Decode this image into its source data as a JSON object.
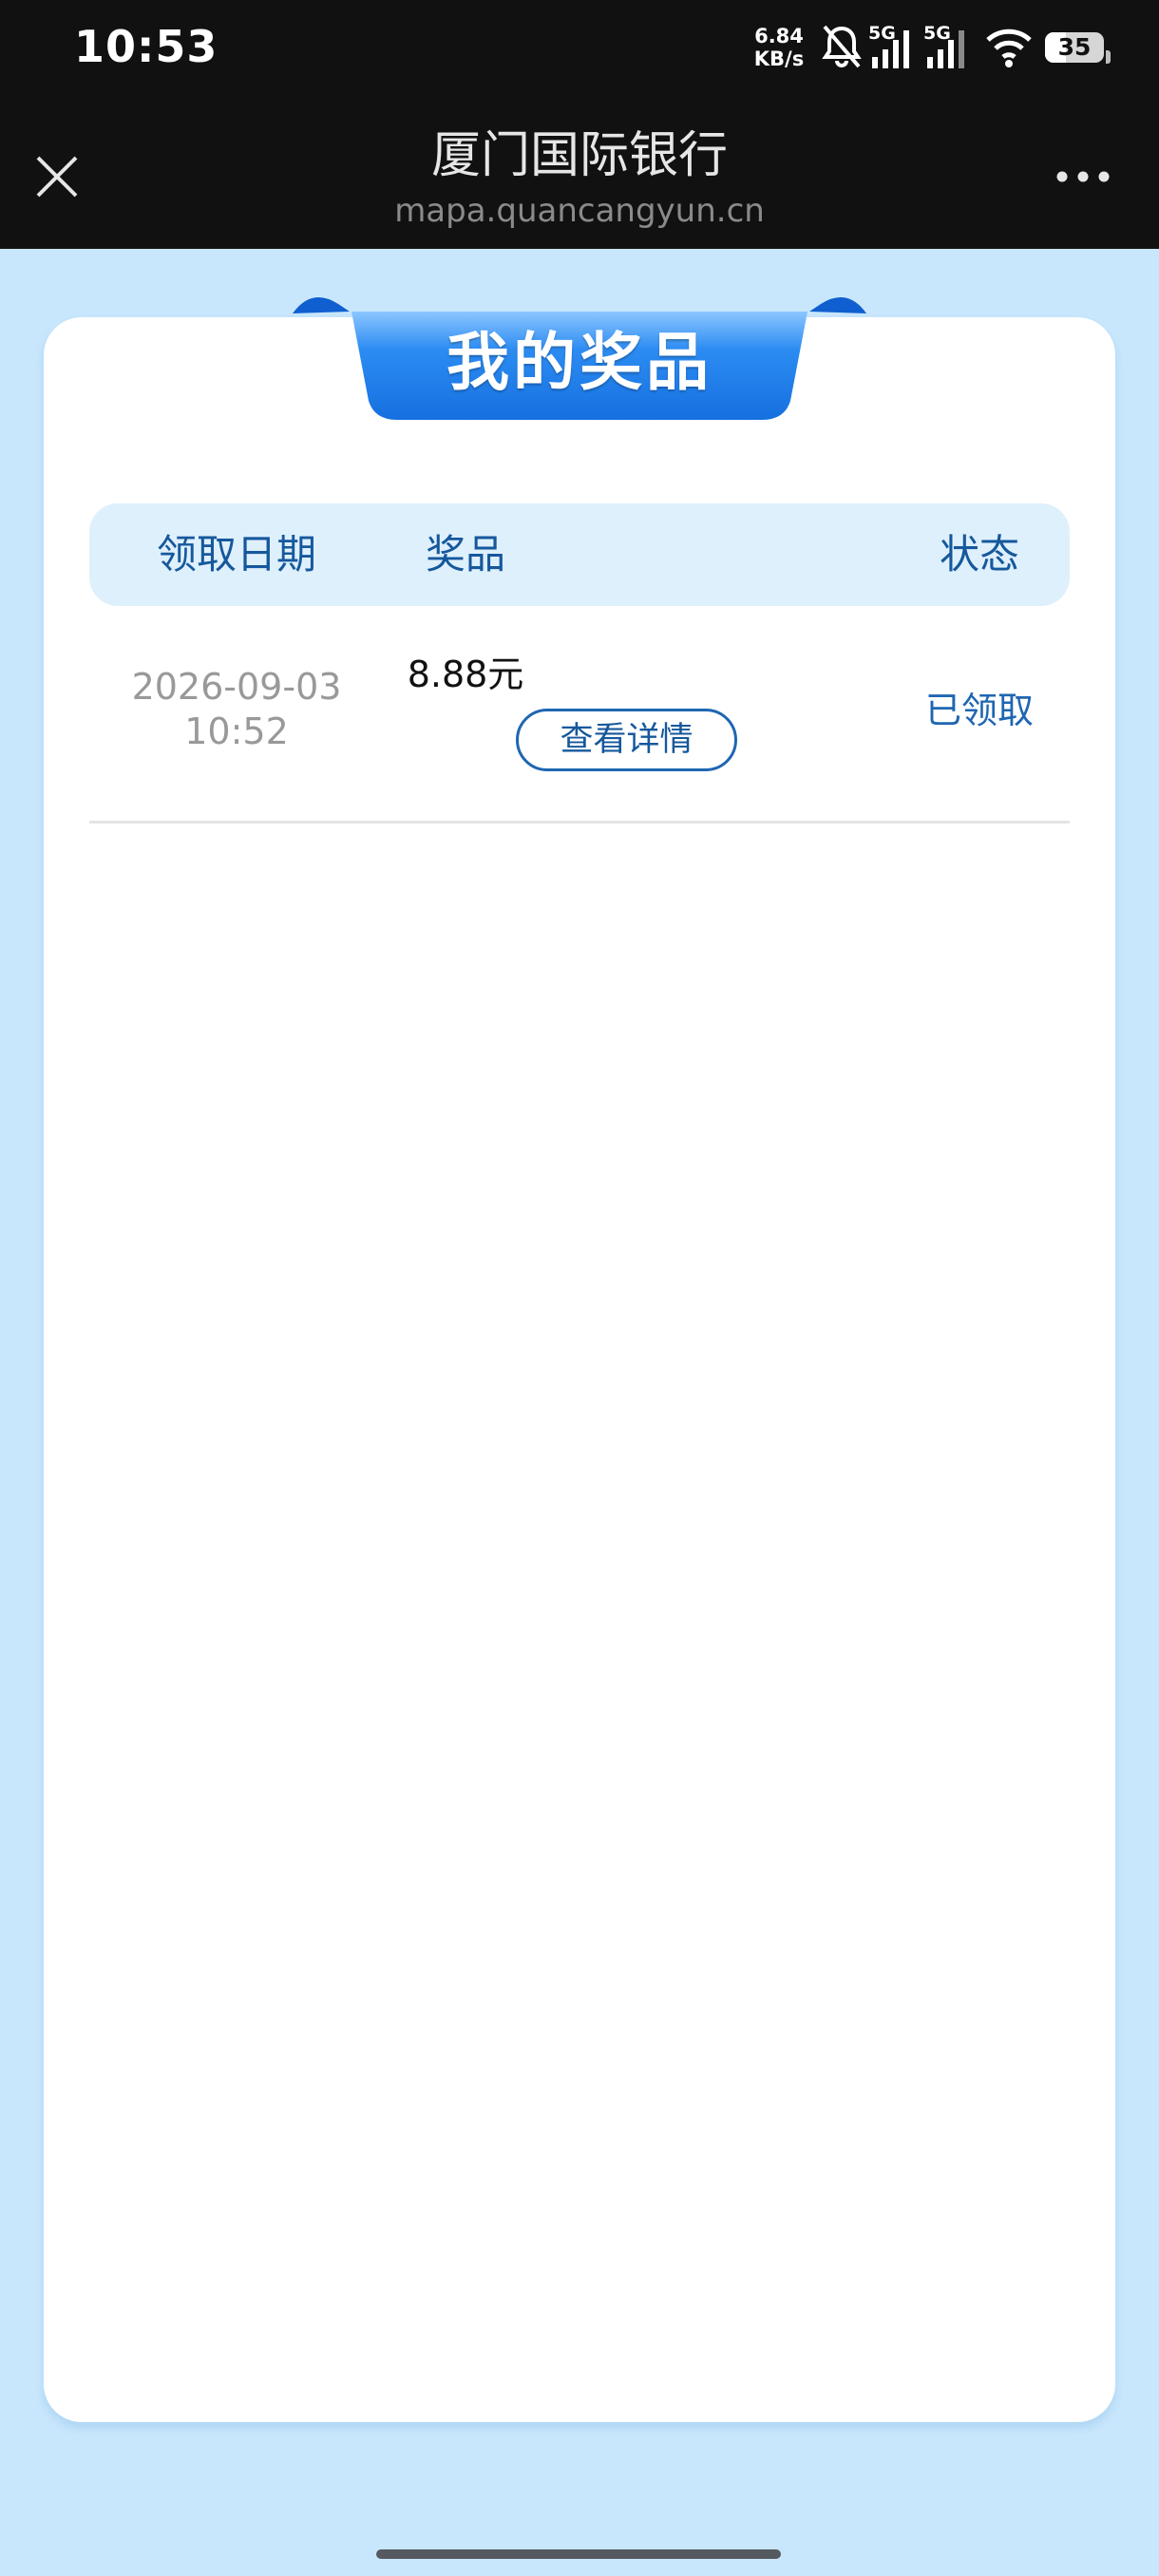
{
  "status_bar": {
    "time": "10:53",
    "net_speed_value": "6.84",
    "net_speed_unit": "KB/s",
    "signal_1_label": "5G",
    "signal_2_label": "5G",
    "battery_level": "35",
    "battery_fraction": 0.35,
    "icons": [
      "bell-muted-icon",
      "cellular-signal-icon",
      "cellular-signal-icon",
      "wifi-icon",
      "battery-icon"
    ]
  },
  "nav": {
    "title": "厦门国际银行",
    "url": "mapa.quancangyun.cn",
    "icons": [
      "close-icon",
      "more-icon"
    ]
  },
  "page": {
    "banner_title": "我的奖品",
    "columns": [
      "领取日期",
      "奖品",
      "状态"
    ],
    "rows": [
      {
        "date": "2026-09-03",
        "time": "10:52",
        "amount": "8.88元",
        "detail_label": "查看详情",
        "status": "已领取"
      }
    ]
  },
  "colors": {
    "background": "#c9e7fc",
    "bar": "#111111",
    "accent_blue": "#1f66b2",
    "header_bg": "#dff0fd",
    "banner_blue": "#1a7ae8"
  }
}
